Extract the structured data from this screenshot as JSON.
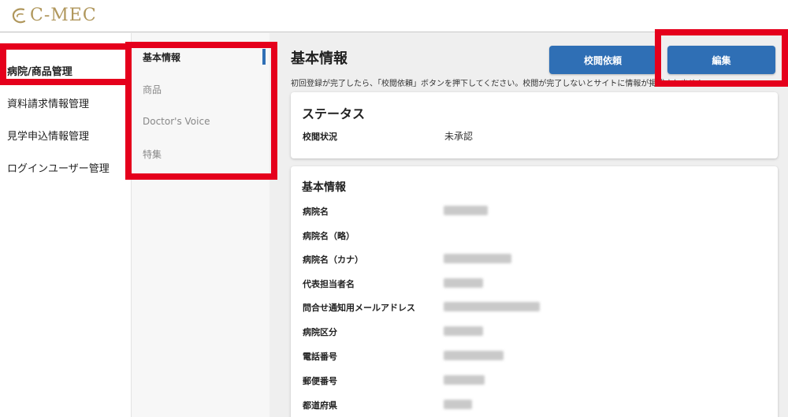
{
  "brand": {
    "logo_text": "C-MEC",
    "accent_color": "#b0975c",
    "primary_color": "#2f6fb5",
    "highlight_color": "#e5001c"
  },
  "sidebar": {
    "items": [
      {
        "label": "病院/商品管理",
        "active": true
      },
      {
        "label": "資料請求情報管理"
      },
      {
        "label": "見学申込情報管理"
      },
      {
        "label": "ログインユーザー管理"
      }
    ]
  },
  "subnav": {
    "items": [
      {
        "label": "基本情報",
        "active": true
      },
      {
        "label": "商品"
      },
      {
        "label": "Doctor's Voice"
      },
      {
        "label": "特集"
      }
    ]
  },
  "main": {
    "title": "基本情報",
    "note": "初回登録が完了したら、「校閲依頼」ボタンを押下してください。校閲が完了しないとサイトに情報が掲載されません",
    "buttons": {
      "review": "校閲依頼",
      "edit": "編集"
    },
    "status_card": {
      "title": "ステータス",
      "rows": [
        {
          "label": "校閲状況",
          "value": "未承認"
        }
      ]
    },
    "info_card": {
      "title": "基本情報",
      "rows": [
        {
          "label": "病院名"
        },
        {
          "label": "病院名（略）"
        },
        {
          "label": "病院名（カナ）"
        },
        {
          "label": "代表担当者名"
        },
        {
          "label": "問合せ通知用メールアドレス"
        },
        {
          "label": "病院区分"
        },
        {
          "label": "電話番号"
        },
        {
          "label": "郵便番号"
        },
        {
          "label": "都道府県"
        }
      ]
    }
  }
}
